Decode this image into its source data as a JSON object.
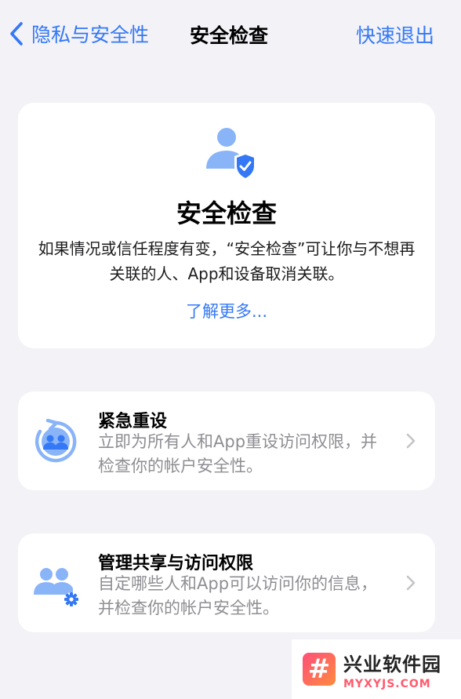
{
  "nav": {
    "back_label": "隐私与安全性",
    "title": "安全检查",
    "exit_label": "快速退出"
  },
  "hero": {
    "title": "安全检查",
    "description": "如果情况或信任程度有变，“安全检查”可让你与不想再关联的人、App和设备取消关联。",
    "link": "了解更多..."
  },
  "options": [
    {
      "title": "紧急重设",
      "subtitle": "立即为所有人和App重设访问权限，并检查你的帐户安全性。",
      "icon": "reset-people-icon"
    },
    {
      "title": "管理共享与访问权限",
      "subtitle": "自定哪些人和App可以访问你的信息，并检查你的帐户安全性。",
      "icon": "people-gear-icon"
    }
  ],
  "watermark": {
    "logo_glyph": "#",
    "name": "兴业软件园",
    "domain": "MYXYJS.COM"
  },
  "colors": {
    "accent": "#3478f6",
    "icon_light": "#8ab4f8",
    "background": "#f2f2f7"
  }
}
